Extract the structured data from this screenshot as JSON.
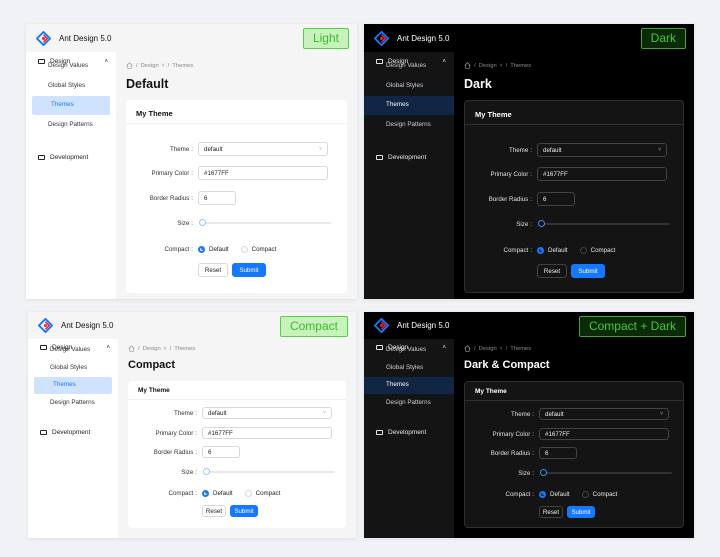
{
  "app_title": "Ant Design 5.0",
  "menu": {
    "group_design": "Design",
    "items": [
      "Design Values",
      "Global Styles",
      "Themes",
      "Design Patterns"
    ],
    "group_development": "Development"
  },
  "breadcrumb": {
    "design": "Design",
    "themes": "Themes",
    "sep": "/"
  },
  "form": {
    "card_title": "My Theme",
    "theme_label": "Theme",
    "theme_value": "default",
    "primary_label": "Primary Color",
    "primary_value": "#1677FF",
    "radius_label": "Border Radius",
    "radius_value": "6",
    "size_label": "Size",
    "compact_label": "Compact",
    "opt_default": "Default",
    "opt_compact": "Compact",
    "colon": ":",
    "reset": "Reset",
    "submit": "Submit"
  },
  "panels": {
    "light": {
      "badge": "Light",
      "title": "Default"
    },
    "dark": {
      "badge": "Dark",
      "title": "Dark"
    },
    "compact": {
      "badge": "Compact",
      "title": "Compact"
    },
    "cdark": {
      "badge": "Compact + Dark",
      "title": "Dark & Compact"
    }
  },
  "colors": {
    "primary": "#1677ff",
    "badge_green": "#3eb82c"
  }
}
